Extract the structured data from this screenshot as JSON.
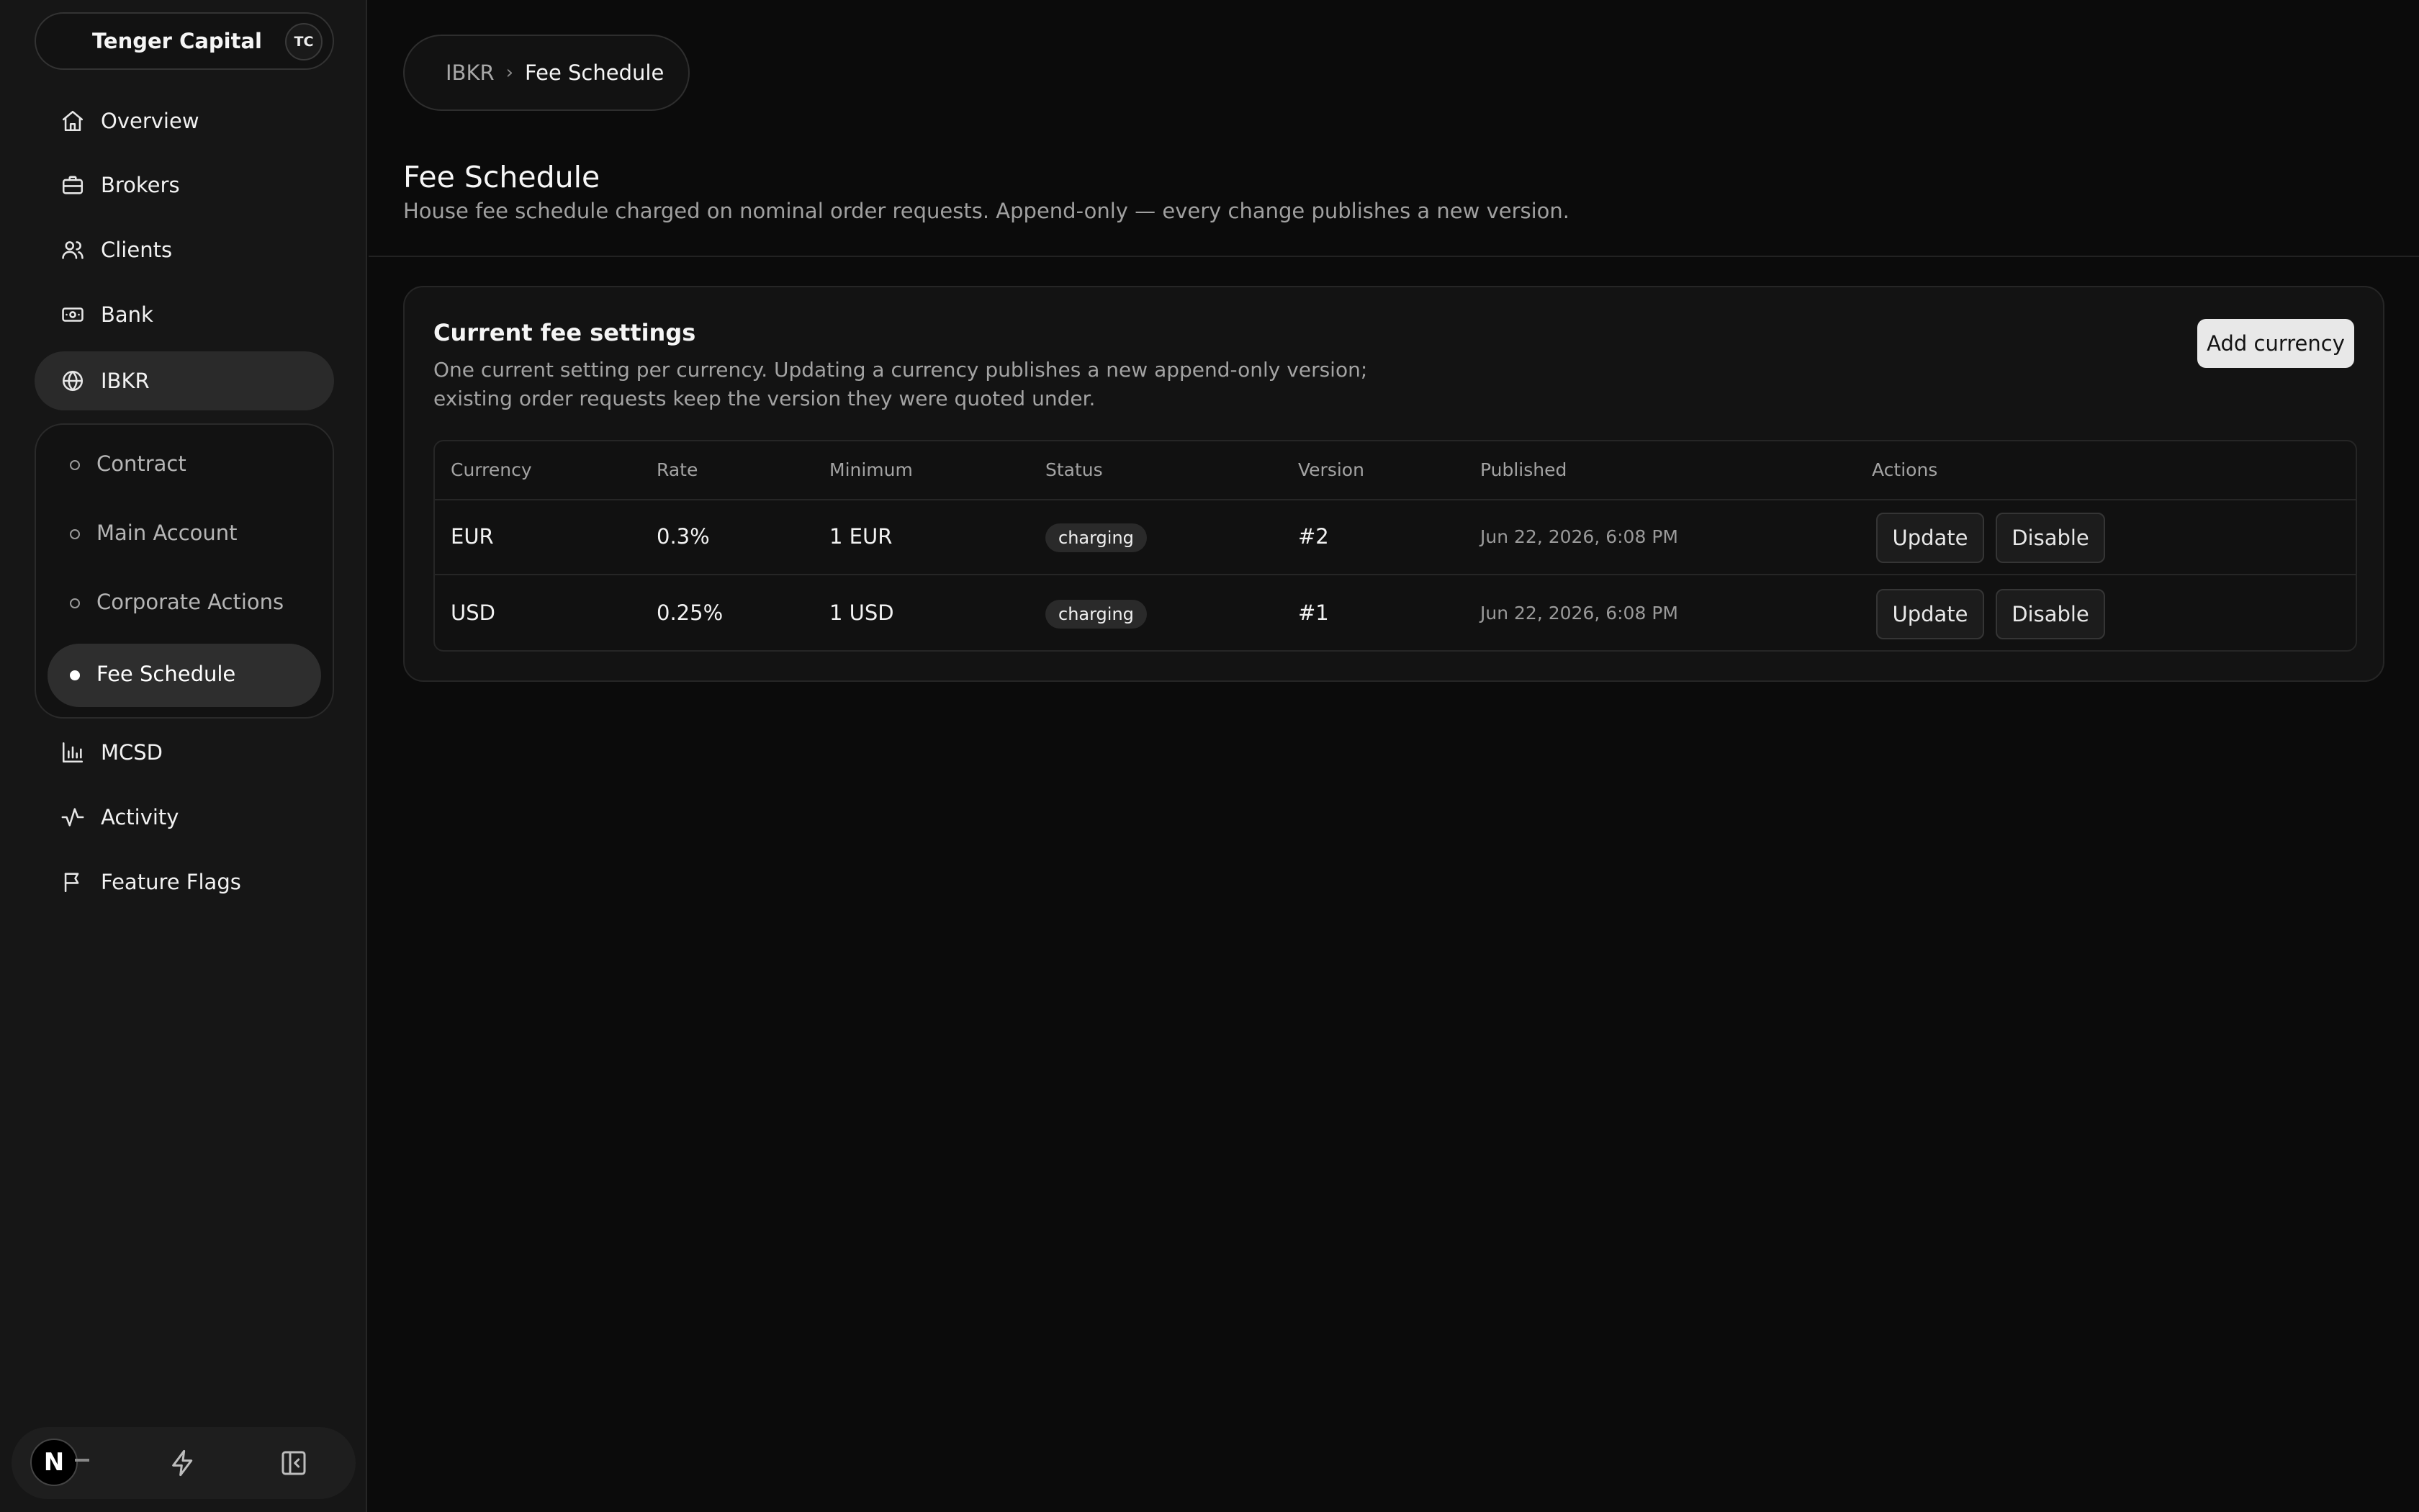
{
  "brand": {
    "name": "Tenger Capital",
    "initials": "TC"
  },
  "nav": {
    "items": [
      {
        "label": "Overview",
        "icon": "home-icon"
      },
      {
        "label": "Brokers",
        "icon": "briefcase-icon"
      },
      {
        "label": "Clients",
        "icon": "users-icon"
      },
      {
        "label": "Bank",
        "icon": "banknote-icon"
      },
      {
        "label": "IBKR",
        "icon": "globe-icon",
        "active": true
      }
    ],
    "sub_items": [
      {
        "label": "Contract"
      },
      {
        "label": "Main Account"
      },
      {
        "label": "Corporate Actions"
      },
      {
        "label": "Fee Schedule",
        "active": true
      }
    ],
    "lower_items": [
      {
        "label": "MCSD",
        "icon": "bar-chart-icon"
      },
      {
        "label": "Activity",
        "icon": "activity-icon"
      },
      {
        "label": "Feature Flags",
        "icon": "flag-icon"
      }
    ]
  },
  "footer": {
    "logo_letter": "N",
    "icons": [
      "zap-icon",
      "collapse-sidebar-icon"
    ]
  },
  "breadcrumb": {
    "parent": "IBKR",
    "separator": "›",
    "current": "Fee Schedule"
  },
  "page": {
    "title": "Fee Schedule",
    "description": "House fee schedule charged on nominal order requests. Append-only — every change publishes a new version."
  },
  "card": {
    "title": "Current fee settings",
    "description": "One current setting per currency. Updating a currency publishes a new append-only version; existing order requests keep the version they were quoted under.",
    "add_button": "Add currency"
  },
  "table": {
    "headers": [
      "Currency",
      "Rate",
      "Minimum",
      "Status",
      "Version",
      "Published",
      "Actions"
    ],
    "rows": [
      {
        "currency": "EUR",
        "rate": "0.3%",
        "minimum": "1 EUR",
        "status": "charging",
        "version": "#2",
        "published": "Jun 22, 2026, 6:08 PM",
        "update": "Update",
        "disable": "Disable"
      },
      {
        "currency": "USD",
        "rate": "0.25%",
        "minimum": "1 USD",
        "status": "charging",
        "version": "#1",
        "published": "Jun 22, 2026, 6:08 PM",
        "update": "Update",
        "disable": "Disable"
      }
    ]
  },
  "colors": {
    "background": "#0b0b0b",
    "sidebar": "#161616",
    "active_pill": "#2a2a2a",
    "primary_button": "#e8e8e8"
  }
}
